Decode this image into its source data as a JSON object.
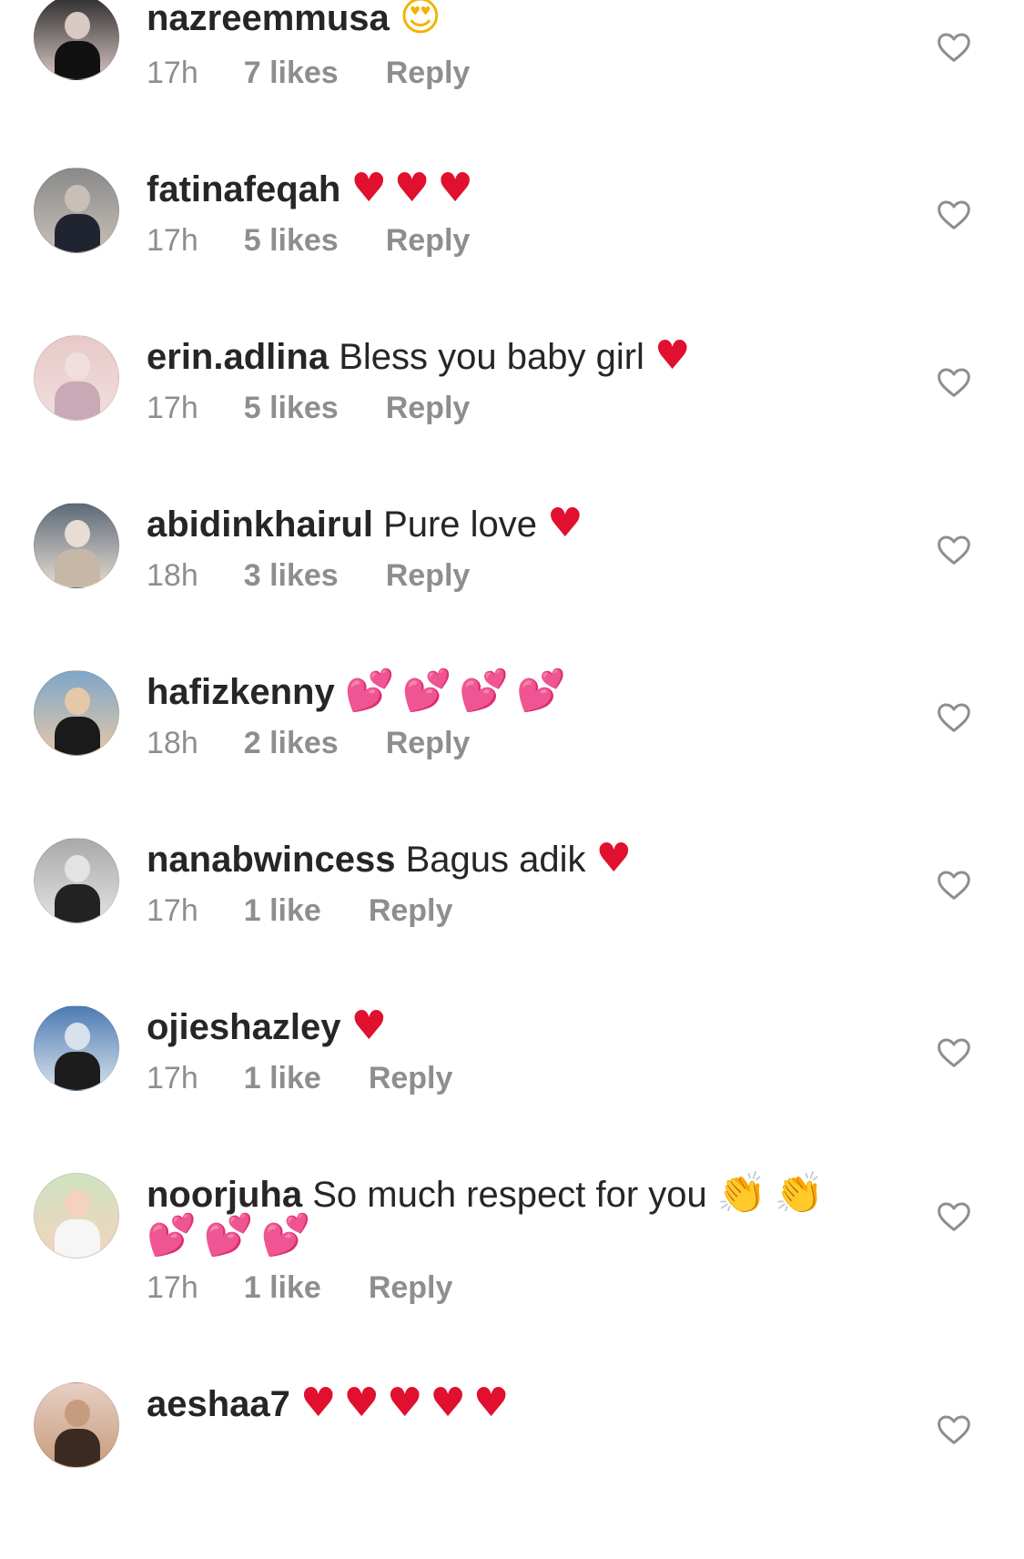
{
  "comments": [
    {
      "username": "nazreemmusa",
      "text": "",
      "emoji": "😍",
      "emoji_color": "gold",
      "time": "17h",
      "likes": "7 likes",
      "reply": "Reply",
      "avatar_colors": [
        "#2b2b2b",
        "#d9c8c4",
        "#111111"
      ]
    },
    {
      "username": "fatinafeqah",
      "text": "",
      "emoji": "♥♥♥",
      "emoji_color": "red",
      "time": "17h",
      "likes": "5 likes",
      "reply": "Reply",
      "avatar_colors": [
        "#8a8a8a",
        "#c8c0b8",
        "#1f2430"
      ]
    },
    {
      "username": "erin.adlina",
      "text": "Bless you baby girl",
      "emoji": "♥",
      "emoji_color": "red",
      "time": "17h",
      "likes": "5 likes",
      "reply": "Reply",
      "avatar_colors": [
        "#e8c9c9",
        "#f1dede",
        "#c9a9b6"
      ]
    },
    {
      "username": "abidinkhairul",
      "text": "Pure love",
      "emoji": "♥",
      "emoji_color": "red",
      "time": "18h",
      "likes": "3 likes",
      "reply": "Reply",
      "avatar_colors": [
        "#5d6a78",
        "#e7ddd2",
        "#c7b7a6"
      ]
    },
    {
      "username": "hafizkenny",
      "text": "",
      "emoji": "💕💕💕💕",
      "emoji_color": "pink",
      "time": "18h",
      "likes": "2 likes",
      "reply": "Reply",
      "avatar_colors": [
        "#7fa6c9",
        "#e5c8a8",
        "#1a1a1a"
      ]
    },
    {
      "username": "nanabwincess",
      "text": "Bagus adik",
      "emoji": "♥",
      "emoji_color": "red",
      "time": "17h",
      "likes": "1 like",
      "reply": "Reply",
      "avatar_colors": [
        "#a9a9a9",
        "#e3e3e3",
        "#222222"
      ]
    },
    {
      "username": "ojieshazley",
      "text": "",
      "emoji": "♥",
      "emoji_color": "red",
      "time": "17h",
      "likes": "1 like",
      "reply": "Reply",
      "avatar_colors": [
        "#4d7bb5",
        "#d9e2ea",
        "#1c1c1c"
      ]
    },
    {
      "username": "noorjuha",
      "text": "So much respect for you",
      "emoji": "👏👏",
      "emoji_color": "gold",
      "emoji2": "💕💕💕",
      "time": "17h",
      "likes": "1 like",
      "reply": "Reply",
      "avatar_colors": [
        "#cfe3c0",
        "#f3d3c0",
        "#f6f6f6"
      ]
    },
    {
      "username": "aeshaa7",
      "text": "",
      "emoji": "♥♥♥♥♥",
      "emoji_color": "red",
      "time": "",
      "likes": "",
      "reply": "",
      "avatar_colors": [
        "#e7cfc3",
        "#c79c7e",
        "#3a2a22"
      ]
    }
  ],
  "colors": {
    "username": "#262626",
    "meta": "#8e8e8e",
    "heart_outline": "#8e8e8e",
    "red_heart": "#e0102e",
    "pink_hearts": "#d81b9b"
  },
  "icons": {
    "like": "heart-outline-icon"
  }
}
